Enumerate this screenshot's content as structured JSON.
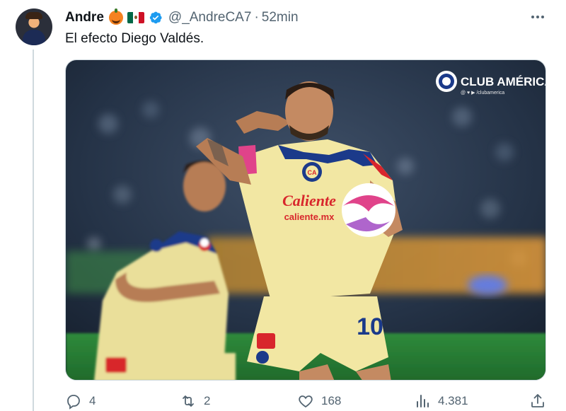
{
  "tweet": {
    "author_name": "Andre",
    "handle": "@_AndreCA7",
    "separator": "·",
    "time": "52min",
    "text": "El efecto Diego Valdés.",
    "icons": [
      "pumpkin-emoji",
      "mexico-flag-emoji",
      "verified-badge-icon",
      "more-options-icon"
    ]
  },
  "media": {
    "brand": "CLUB AMÉRICA",
    "brand_social": "@ ♥ ▶ /clubamerica",
    "sponsor": "Caliente",
    "sponsor_url": "caliente.mx",
    "jersey_number": "10",
    "colors": {
      "jersey": "#f2e7a3",
      "blue": "#1b3a8a",
      "red": "#d8262c",
      "pink": "#e0438a",
      "pitch": "#2f8a3b"
    }
  },
  "actions": {
    "reply_count": "4",
    "retweet_count": "2",
    "like_count": "168",
    "view_count": "4.381"
  }
}
